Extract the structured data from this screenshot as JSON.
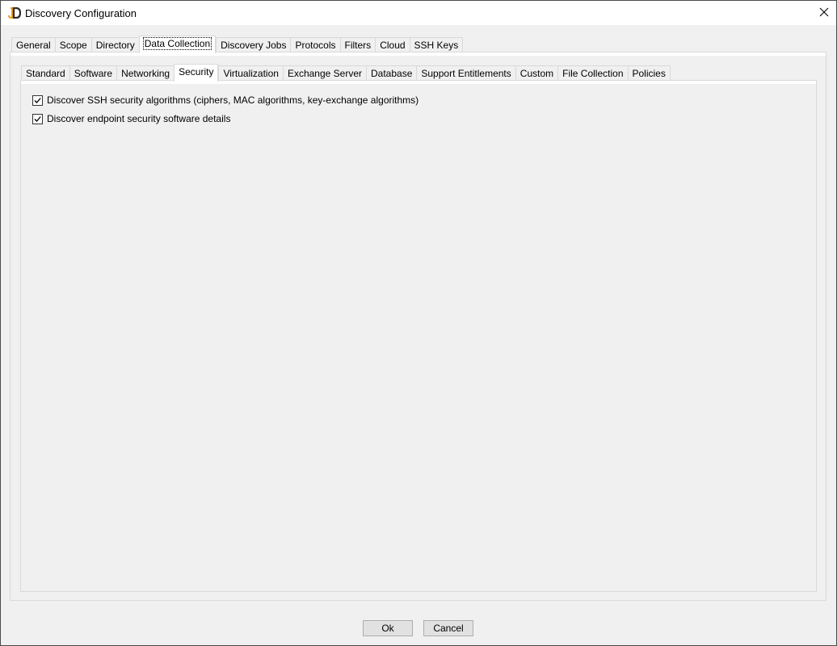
{
  "window": {
    "title": "Discovery Configuration",
    "icon": "jdisc-logo-icon"
  },
  "outer_tabs": [
    {
      "label": "General",
      "selected": false
    },
    {
      "label": "Scope",
      "selected": false
    },
    {
      "label": "Directory",
      "selected": false
    },
    {
      "label": "Data Collection",
      "selected": true
    },
    {
      "label": "Discovery Jobs",
      "selected": false
    },
    {
      "label": "Protocols",
      "selected": false
    },
    {
      "label": "Filters",
      "selected": false
    },
    {
      "label": "Cloud",
      "selected": false
    },
    {
      "label": "SSH Keys",
      "selected": false
    }
  ],
  "inner_tabs": [
    {
      "label": "Standard",
      "selected": false
    },
    {
      "label": "Software",
      "selected": false
    },
    {
      "label": "Networking",
      "selected": false
    },
    {
      "label": "Security",
      "selected": true
    },
    {
      "label": "Virtualization",
      "selected": false
    },
    {
      "label": "Exchange Server",
      "selected": false
    },
    {
      "label": "Database",
      "selected": false
    },
    {
      "label": "Support Entitlements",
      "selected": false
    },
    {
      "label": "Custom",
      "selected": false
    },
    {
      "label": "File Collection",
      "selected": false
    },
    {
      "label": "Policies",
      "selected": false
    }
  ],
  "security": {
    "options": [
      {
        "label": "Discover SSH security algorithms (ciphers, MAC algorithms, key-exchange algorithms)",
        "checked": true
      },
      {
        "label": "Discover endpoint security software details",
        "checked": true
      }
    ]
  },
  "buttons": {
    "ok": "Ok",
    "cancel": "Cancel"
  },
  "colors": {
    "background": "#f0f0f0",
    "logo_orange": "#f39c12",
    "logo_dark": "#2b2b2b"
  }
}
